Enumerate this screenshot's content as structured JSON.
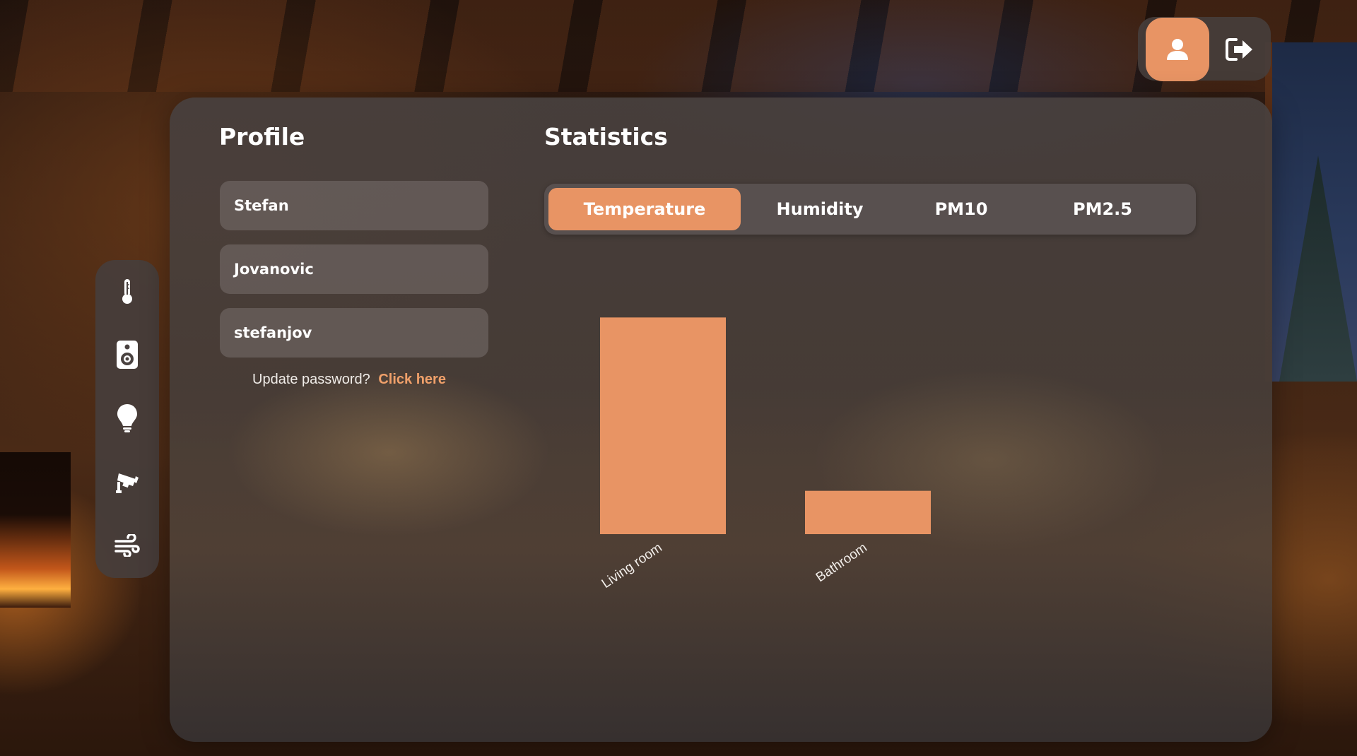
{
  "topnav": {
    "profile_icon": "user-icon",
    "logout_icon": "logout-icon"
  },
  "sidebar": {
    "items": [
      {
        "icon": "thermometer-icon"
      },
      {
        "icon": "speaker-icon"
      },
      {
        "icon": "lightbulb-icon"
      },
      {
        "icon": "security-camera-icon"
      },
      {
        "icon": "wind-icon"
      }
    ]
  },
  "profile": {
    "title": "Profile",
    "first_name": "Stefan",
    "last_name": "Jovanovic",
    "username": "stefanjov",
    "password_prompt": "Update password?",
    "password_link": "Click here"
  },
  "statistics": {
    "title": "Statistics",
    "tabs": [
      {
        "label": "Temperature",
        "active": true
      },
      {
        "label": "Humidity",
        "active": false
      },
      {
        "label": "PM10",
        "active": false
      },
      {
        "label": "PM2.5",
        "active": false
      }
    ]
  },
  "colors": {
    "accent": "#e89464",
    "link": "#f0a06a"
  },
  "chart_data": {
    "type": "bar",
    "categories": [
      "Living room",
      "Bathroom"
    ],
    "values": [
      25,
      5
    ],
    "title": "",
    "xlabel": "",
    "ylabel": "",
    "ylim": [
      0,
      30
    ],
    "grid": false
  }
}
